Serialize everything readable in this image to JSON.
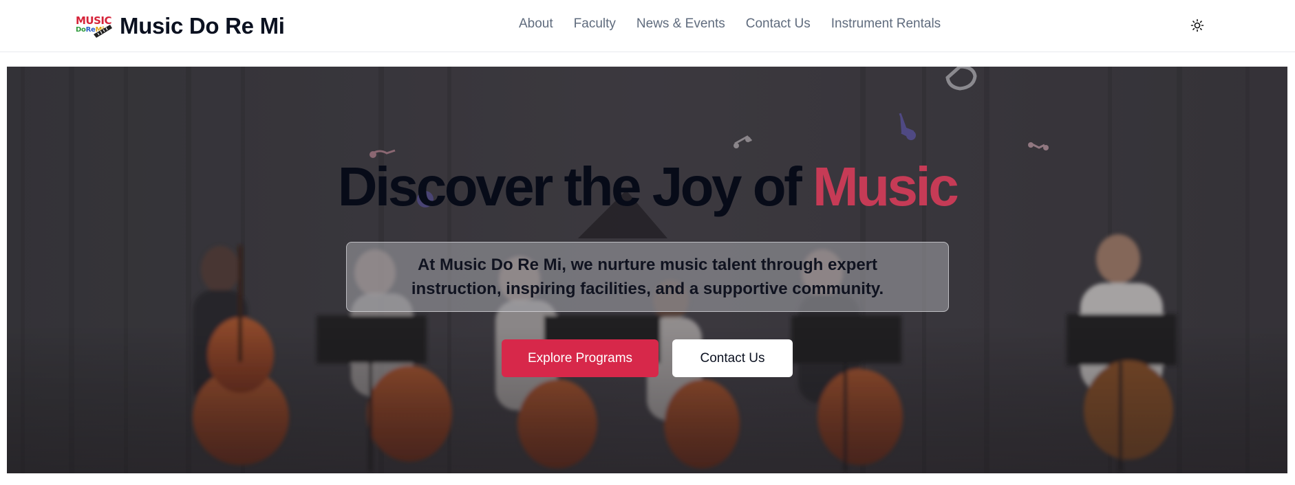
{
  "header": {
    "logo": {
      "top_text": "MUSIC",
      "sub_do": "Do",
      "sub_re": "Re",
      "sub_mi": "Mi"
    },
    "brand_name": "Music Do Re Mi",
    "nav": [
      {
        "label": "About"
      },
      {
        "label": "Faculty"
      },
      {
        "label": "News & Events"
      },
      {
        "label": "Contact Us"
      },
      {
        "label": "Instrument Rentals"
      }
    ],
    "theme_toggle_icon": "sun-icon"
  },
  "hero": {
    "title_main": "Discover the Joy of ",
    "title_accent": "Music",
    "description": "At Music Do Re Mi, we nurture music talent through expert instruction, inspiring facilities, and a supportive community.",
    "primary_button": "Explore Programs",
    "secondary_button": "Contact Us",
    "background_image": "cello ensemble performing on stage"
  },
  "colors": {
    "accent": "#d7284a",
    "title_accent": "#c63b56",
    "nav_text": "#5f6b7d",
    "heading": "#0b1120"
  }
}
